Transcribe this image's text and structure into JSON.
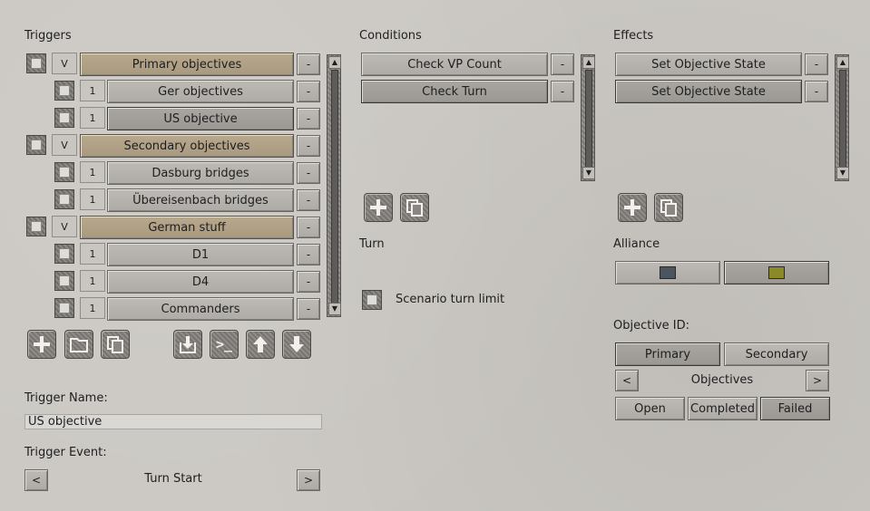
{
  "triggers": {
    "label": "Triggers",
    "rows": [
      {
        "kind": "group",
        "toggle": "V",
        "label": "Primary objectives",
        "remove": "-"
      },
      {
        "kind": "item",
        "num": "1",
        "label": "Ger objectives",
        "remove": "-"
      },
      {
        "kind": "item",
        "num": "1",
        "label": "US objective",
        "remove": "-",
        "selected": true
      },
      {
        "kind": "group",
        "toggle": "V",
        "label": "Secondary objectives",
        "remove": "-"
      },
      {
        "kind": "item",
        "num": "1",
        "label": "Dasburg bridges",
        "remove": "-"
      },
      {
        "kind": "item",
        "num": "1",
        "label": "Übereisenbach bridges",
        "remove": "-"
      },
      {
        "kind": "group",
        "toggle": "V",
        "label": "German stuff",
        "remove": "-"
      },
      {
        "kind": "item",
        "num": "1",
        "label": "D1",
        "remove": "-"
      },
      {
        "kind": "item",
        "num": "1",
        "label": "D4",
        "remove": "-"
      },
      {
        "kind": "item",
        "num": "1",
        "label": "Commanders",
        "remove": "-"
      }
    ],
    "toolbar_left": [
      "add-icon",
      "folder-icon",
      "copy-icon"
    ],
    "toolbar_right": [
      "import-icon",
      "terminal-icon",
      "arrow-up-icon",
      "arrow-down-icon"
    ],
    "terminal_glyph": ">_"
  },
  "trigger_name": {
    "label": "Trigger Name:",
    "value": "US objective"
  },
  "trigger_event": {
    "label": "Trigger Event:",
    "value": "Turn Start",
    "prev": "<",
    "next": ">"
  },
  "conditions": {
    "label": "Conditions",
    "rows": [
      {
        "label": "Check VP Count",
        "remove": "-"
      },
      {
        "label": "Check Turn",
        "remove": "-",
        "selected": true
      }
    ],
    "toolbar": [
      "add-icon",
      "copy-icon"
    ]
  },
  "turn": {
    "label": "Turn",
    "checkbox_label": "Scenario turn limit"
  },
  "effects": {
    "label": "Effects",
    "rows": [
      {
        "label": "Set Objective State",
        "remove": "-"
      },
      {
        "label": "Set Objective State",
        "remove": "-",
        "selected": true
      }
    ],
    "toolbar": [
      "add-icon",
      "copy-icon"
    ]
  },
  "alliance": {
    "label": "Alliance",
    "options": [
      {
        "color": "#4a5560",
        "selected": false
      },
      {
        "color": "#8a8a28",
        "selected": true
      }
    ]
  },
  "objective_id": {
    "label": "Objective ID:",
    "types": [
      {
        "label": "Primary",
        "selected": true
      },
      {
        "label": "Secondary",
        "selected": false
      }
    ],
    "nav": {
      "prev": "<",
      "value": "Objectives",
      "next": ">"
    },
    "states": [
      {
        "label": "Open",
        "selected": false
      },
      {
        "label": "Completed",
        "selected": false
      },
      {
        "label": "Failed",
        "selected": true
      }
    ]
  }
}
